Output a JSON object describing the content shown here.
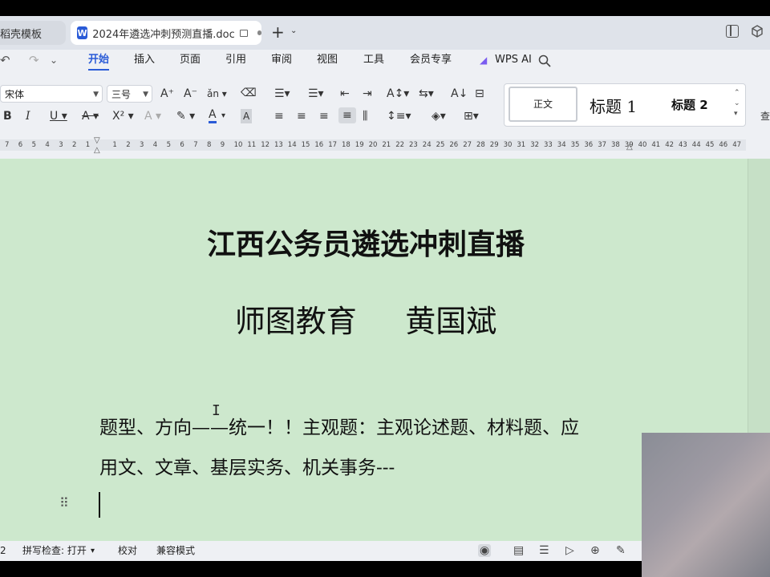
{
  "tabs": {
    "inactive_label": "稻壳模板",
    "active_logo": "W",
    "active_label": "2024年遴选冲刺预测直播.doc",
    "new_tab_symbol": "+",
    "new_tab_arrow": "⌄"
  },
  "menu": {
    "items": [
      "开始",
      "插入",
      "页面",
      "引用",
      "审阅",
      "视图",
      "工具",
      "会员专享"
    ],
    "ai_label": "WPS AI",
    "undo_icon": "↶",
    "redo_icon": "↷",
    "more_icon": "⌄"
  },
  "ribbon": {
    "font_name": "宋体",
    "font_size": "三号",
    "styles": {
      "normal": "正文",
      "heading1": "标题 1",
      "heading2": "标题 2"
    },
    "find_label": "查"
  },
  "ruler": {
    "ticks": [
      "7",
      "6",
      "5",
      "4",
      "3",
      "2",
      "1",
      "",
      "1",
      "2",
      "3",
      "4",
      "5",
      "6",
      "7",
      "8",
      "9",
      "10",
      "11",
      "12",
      "13",
      "14",
      "15",
      "16",
      "17",
      "18",
      "19",
      "20",
      "21",
      "22",
      "23",
      "24",
      "25",
      "26",
      "27",
      "28",
      "29",
      "30",
      "31",
      "32",
      "33",
      "34",
      "35",
      "36",
      "37",
      "38",
      "39",
      "40",
      "41",
      "42",
      "43",
      "44",
      "45",
      "46",
      "47"
    ]
  },
  "document": {
    "title": "江西公务员遴选冲刺直播",
    "subtitle": "师图教育     黄国斌",
    "body_line1": "题型、方向——统一！！主观题：主观论述题、材料题、应",
    "body_line2": "用文、文章、基层实务、机关事务---"
  },
  "status": {
    "page_fragment": "2",
    "spellcheck": "拼写检查: 打开",
    "proofread": "校对",
    "compat_mode": "兼容模式"
  },
  "colors": {
    "accent": "#2a5bd7",
    "page_background": "#cde8cd",
    "chrome": "#eef0f4"
  }
}
